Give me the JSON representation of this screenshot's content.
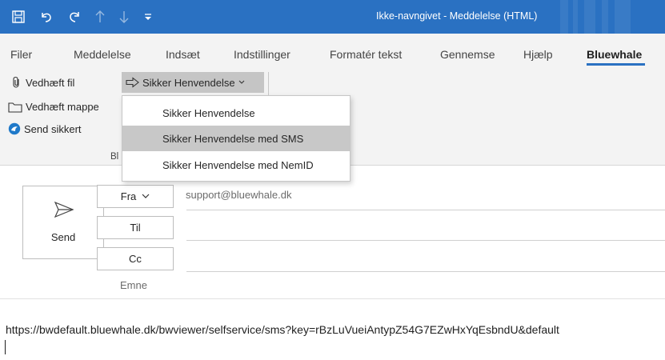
{
  "window": {
    "title": "Ikke-navngivet  -  Meddelelse (HTML)",
    "accent_color": "#2a71c2"
  },
  "quick_access": {
    "icons": [
      "save-icon",
      "undo-icon",
      "redo-icon",
      "up-arrow-icon",
      "down-arrow-icon",
      "customize-dropdown-icon"
    ]
  },
  "tabs": [
    {
      "label": "Filer"
    },
    {
      "label": "Meddelelse"
    },
    {
      "label": "Indsæt"
    },
    {
      "label": "Indstillinger"
    },
    {
      "label": "Formatér tekst"
    },
    {
      "label": "Gennemse"
    },
    {
      "label": "Hjælp"
    },
    {
      "label": "Bluewhale",
      "active": true
    }
  ],
  "ribbon": {
    "attach_file": "Vedhæft fil",
    "attach_folder": "Vedhæft mappe",
    "send_secure": "Send sikkert",
    "secure_dropdown": "Sikker Henvendelse",
    "group_label": "Bl"
  },
  "dropdown_menu": {
    "items": [
      {
        "label": "Sikker Henvendelse",
        "highlighted": false
      },
      {
        "label": "Sikker Henvendelse med SMS",
        "highlighted": true
      },
      {
        "label": "Sikker Henvendelse med NemID",
        "highlighted": false
      }
    ]
  },
  "compose": {
    "send_label": "Send",
    "from_label": "Fra",
    "to_label": "Til",
    "cc_label": "Cc",
    "subject_label": "Emne",
    "from_address": "support@bluewhale.dk",
    "to_value": "",
    "cc_value": "",
    "subject_value": ""
  },
  "body": {
    "text": "https://bwdefault.bluewhale.dk/bwviewer/selfservice/sms?key=rBzLuVueiAntypZ54G7EZwHxYqEsbndU&default"
  }
}
